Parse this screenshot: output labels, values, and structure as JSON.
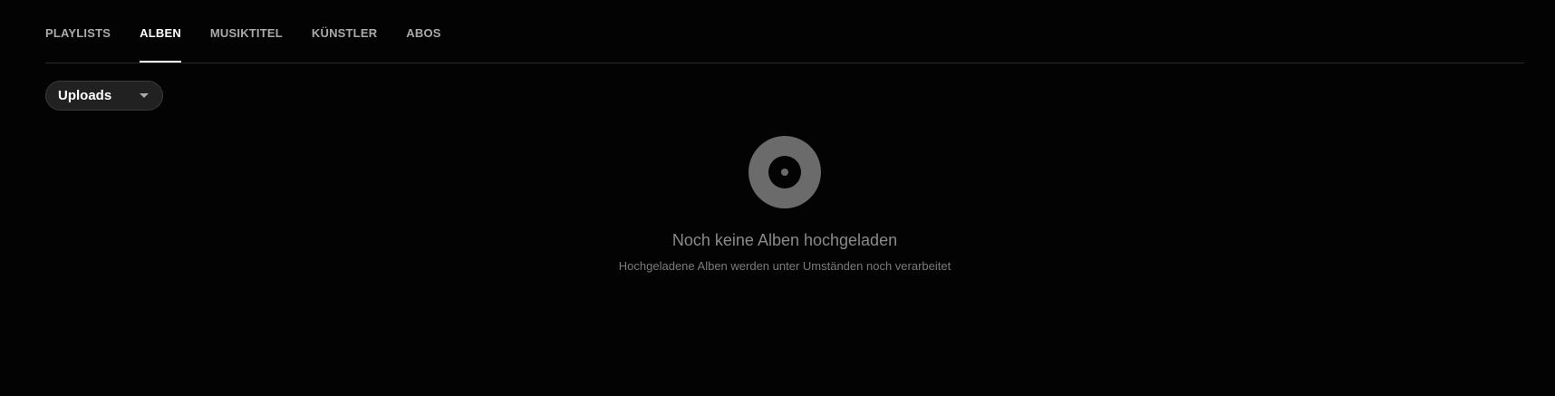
{
  "tabs": [
    {
      "label": "PLAYLISTS",
      "active": false
    },
    {
      "label": "ALBEN",
      "active": true
    },
    {
      "label": "MUSIKTITEL",
      "active": false
    },
    {
      "label": "KÜNSTLER",
      "active": false
    },
    {
      "label": "ABOS",
      "active": false
    }
  ],
  "filter": {
    "selected": "Uploads",
    "icon": "chevron-down-icon"
  },
  "empty_state": {
    "icon": "album-disc-icon",
    "title": "Noch keine Alben hochgeladen",
    "subtitle": "Hochgeladene Alben werden unter Umständen noch verarbeitet"
  },
  "colors": {
    "background": "#030303",
    "active_tab": "#ffffff",
    "inactive_tab": "#aaaaaa",
    "disc": "#6b6b6b"
  }
}
